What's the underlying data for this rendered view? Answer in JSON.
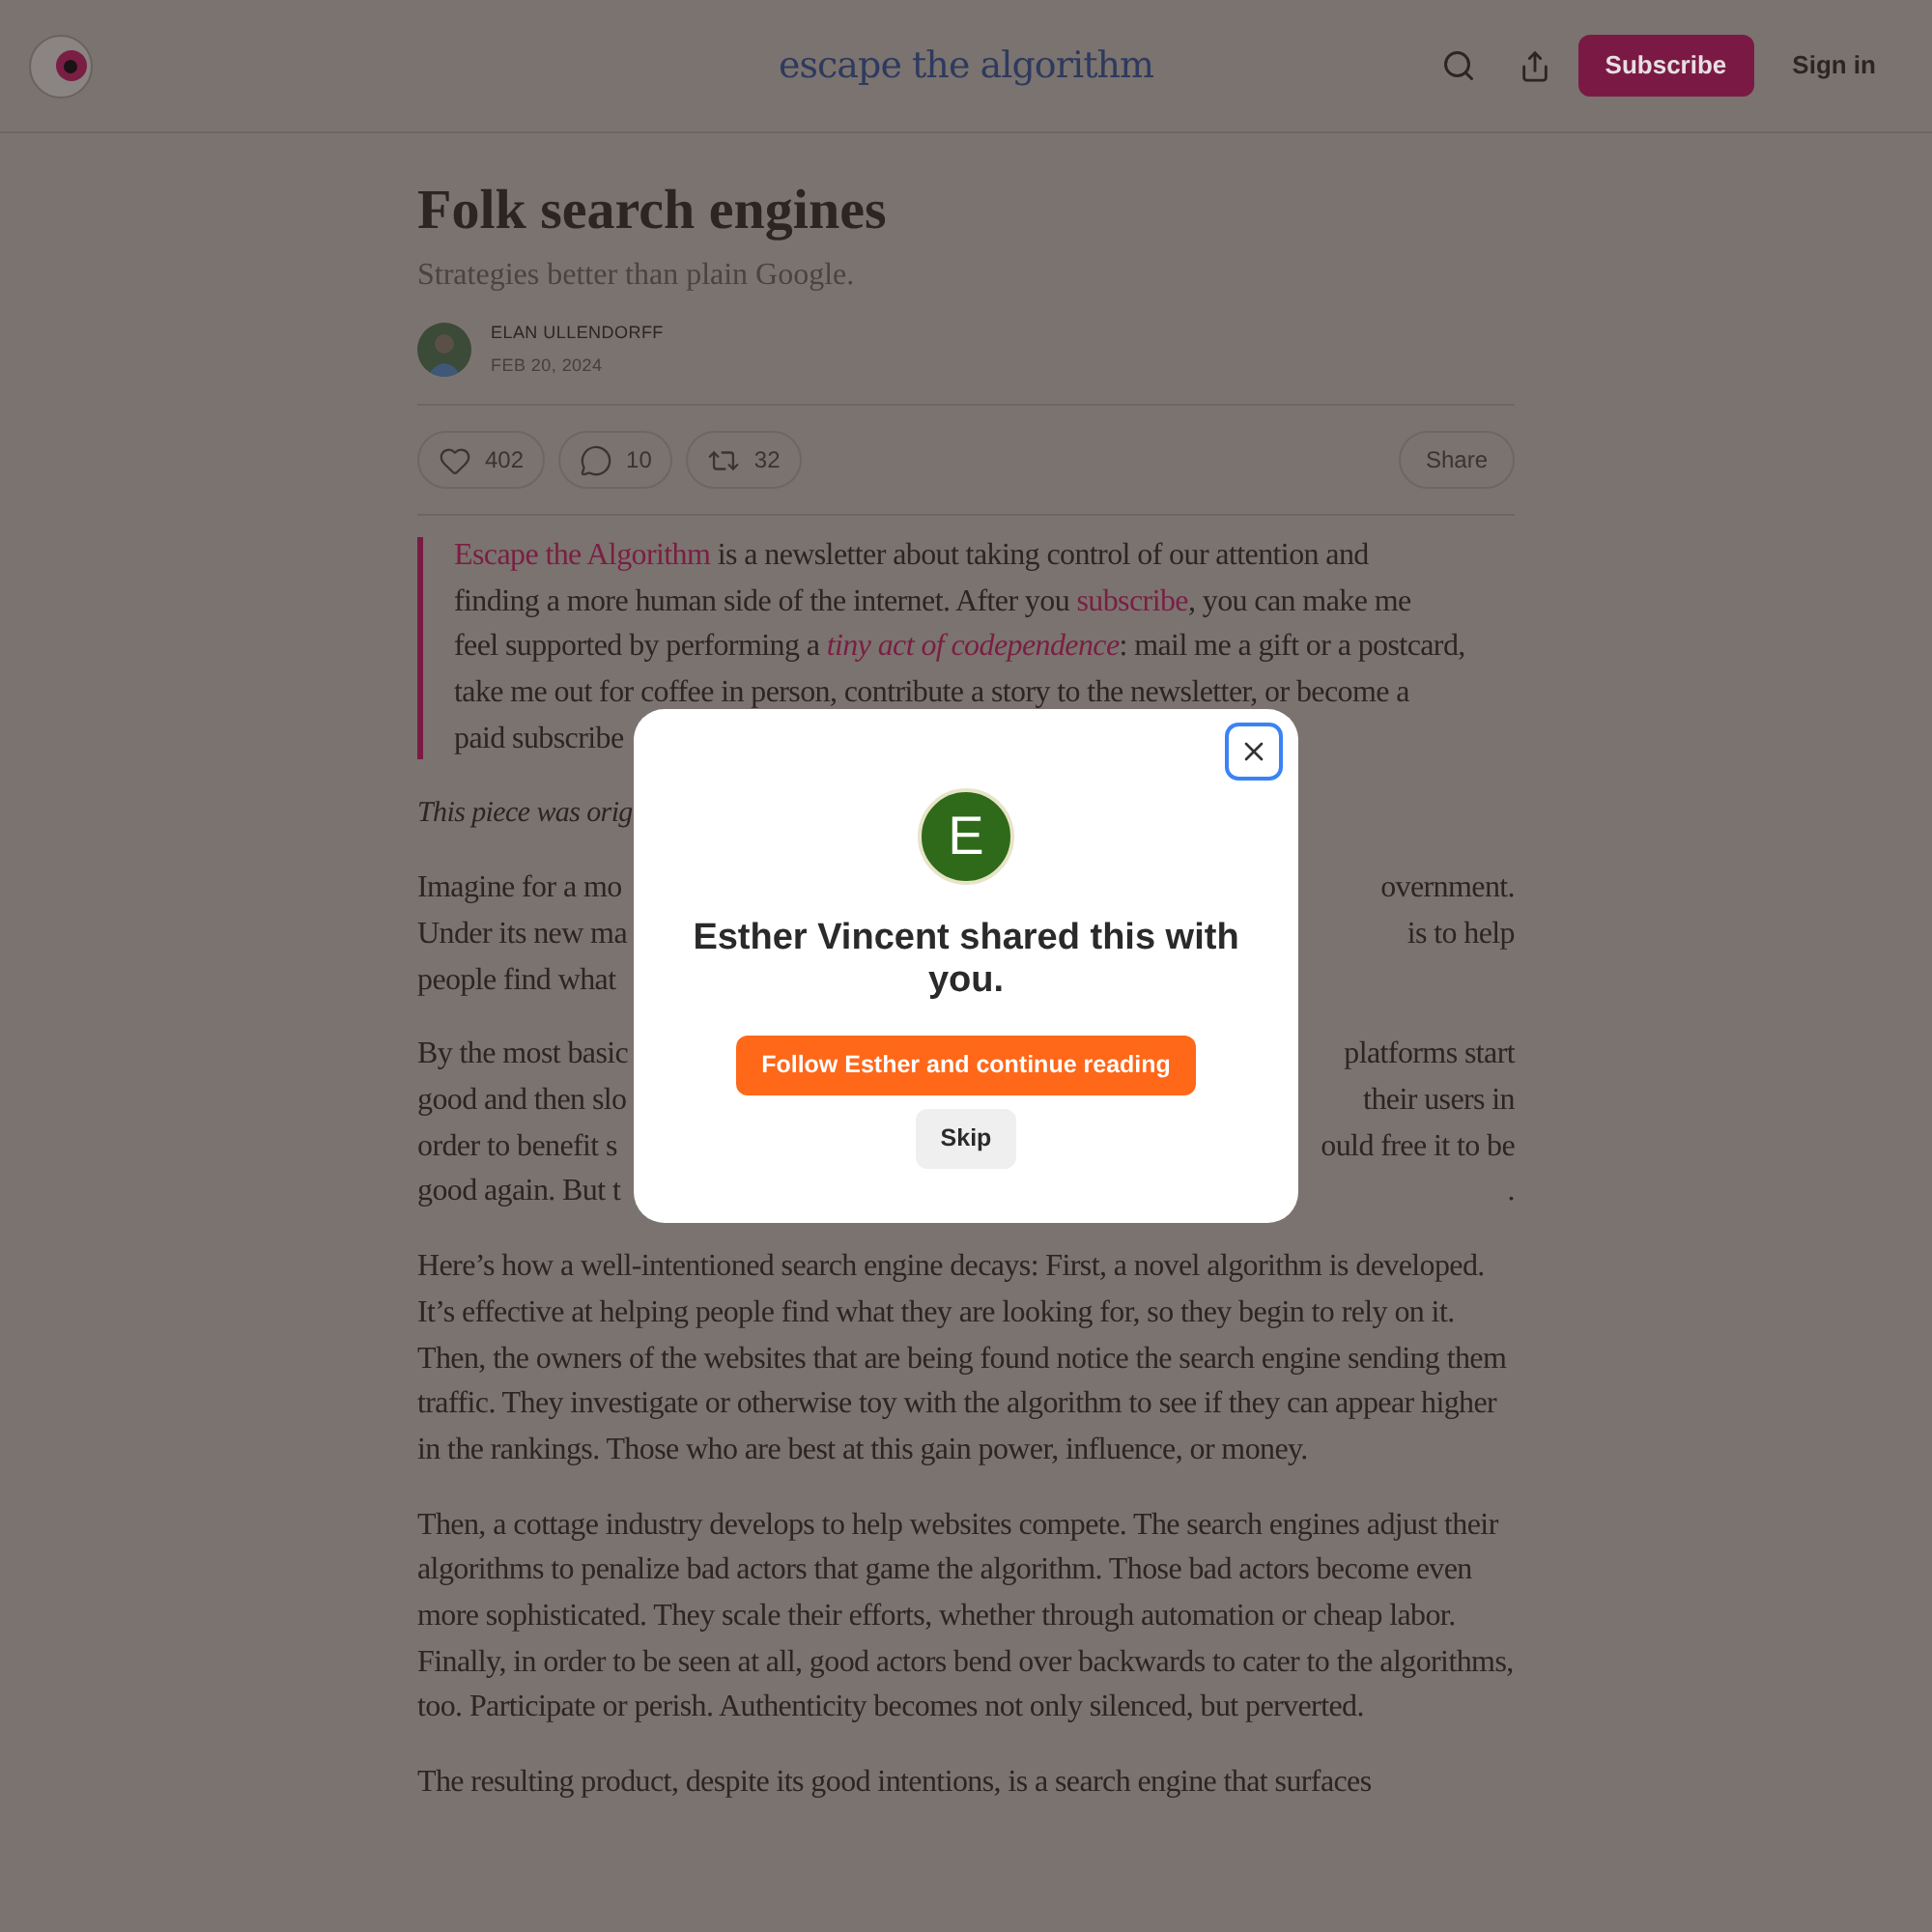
{
  "header": {
    "logo_text": "escape the algorithm",
    "subscribe_button": "Subscribe",
    "sign_in_button": "Sign in"
  },
  "article": {
    "title": "Folk search engines",
    "subtitle": "Strategies better than plain Google.",
    "author": "ELAN ULLENDORFF",
    "date": "FEB 20, 2024",
    "reactions": [
      {
        "kind": "like",
        "count": "402"
      },
      {
        "kind": "comment",
        "count": "10"
      },
      {
        "kind": "restack",
        "count": "32"
      }
    ],
    "share_button": "Share",
    "callout_lines": [
      [
        {
          "kind": "link",
          "text": "Escape the Algorithm"
        },
        {
          "kind": "plain",
          "text": " is a newsletter about taking control of our attention and"
        }
      ],
      [
        {
          "kind": "plain",
          "text": "finding a more human side of the internet. After you "
        },
        {
          "kind": "link",
          "text": "subscribe"
        },
        {
          "kind": "plain",
          "text": ", you can make me"
        }
      ],
      [
        {
          "kind": "plain",
          "text": "feel supported by performing a "
        },
        {
          "kind": "italic_link",
          "text": "tiny act of codependence"
        },
        {
          "kind": "plain",
          "text": ": mail me a gift or a postcard,"
        }
      ],
      [
        {
          "kind": "plain",
          "text": "take me out for coffee in person, contribute a story to the newsletter, or become a"
        }
      ],
      [
        {
          "kind": "plain",
          "text": "paid subscribe"
        }
      ]
    ],
    "covered_paragraphs": [
      {
        "lines": [
          {
            "left": "This piece was orig"
          }
        ]
      },
      {
        "lines": [
          {
            "left": "Imagine for a mo",
            "right": "overnment."
          },
          {
            "left": "Under its new ma",
            "right": "is to help"
          },
          {
            "left": "people find what"
          }
        ]
      },
      {
        "lines": [
          {
            "left": "By the most basic",
            "right": "platforms start"
          },
          {
            "left": "good and then slo",
            "right": "their users in"
          },
          {
            "left": "order to benefit s",
            "right": "ould free it to be"
          },
          {
            "left": "good again. But t",
            "right": "."
          }
        ]
      }
    ],
    "paragraphs": [
      "Here’s how a well-intentioned search engine decays: First, a novel algorithm is developed. It’s effective at helping people find what they are looking for, so they begin to rely on it. Then, the owners of the websites that are being found notice the search engine sending them traffic. They investigate or otherwise toy with the algorithm to see if they can appear higher in the rankings. Those who are best at this gain power, influence, or money.",
      "Then, a cottage industry develops to help websites compete. The search engines adjust their algorithms to penalize bad actors that game the algorithm. Those bad actors become even more sophisticated. They scale their efforts, whether through automation or cheap labor. Finally, in order to be seen at all, good actors bend over backwards to cater to the algorithms, too. Participate or perish. Authenticity becomes not only silenced, but perverted.",
      "The resulting product, despite its good intentions, is a search engine that surfaces"
    ]
  },
  "modal": {
    "avatar_letter": "E",
    "heading": "Esther Vincent shared this with you.",
    "follow_button": "Follow Esther and continue reading",
    "skip_button": "Skip"
  }
}
